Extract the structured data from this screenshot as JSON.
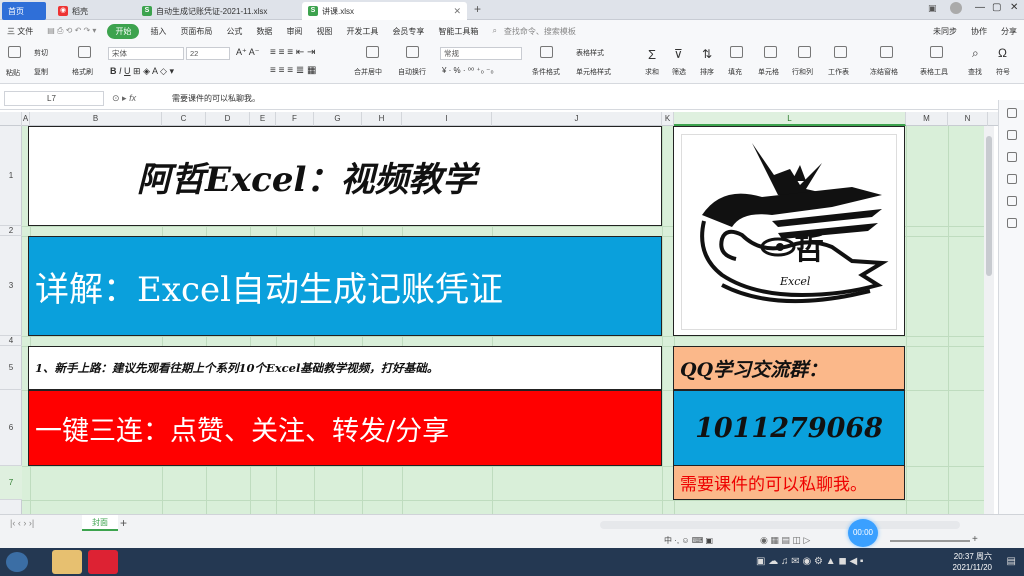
{
  "tabs": [
    {
      "label": "首页",
      "icon": "home-icon"
    },
    {
      "label": "稻壳",
      "icon": "docer-icon"
    },
    {
      "label": "自动生成记账凭证-2021-11.xlsx",
      "icon": "sheet-icon"
    },
    {
      "label": "讲课.xlsx",
      "icon": "sheet-icon"
    }
  ],
  "menu": {
    "file": "三 文件",
    "items": [
      "开始",
      "插入",
      "页面布局",
      "公式",
      "数据",
      "审阅",
      "视图",
      "开发工具",
      "会员专享",
      "智能工具箱"
    ],
    "search": "查找命令、搜索模板",
    "sync": "未同步",
    "collab": "协作",
    "share": "分享"
  },
  "ribbon": {
    "paste": "粘贴",
    "cut": "剪切",
    "copy": "复制",
    "format_painter": "格式刷",
    "font": "宋体",
    "size": "22",
    "merge": "合并居中",
    "wrap": "自动换行",
    "number_format": "常规",
    "cond_format": "条件格式",
    "table_style": "表格样式",
    "cell_style": "单元格样式",
    "sum": "求和",
    "filter": "筛选",
    "sort": "排序",
    "fill": "填充",
    "cell": "单元格",
    "rowcol": "行和列",
    "sheet": "工作表",
    "freeze": "冻结窗格",
    "table_tools": "表格工具",
    "find": "查找",
    "symbol": "符号"
  },
  "formula_bar": {
    "name_box": "L7",
    "fx": "fx",
    "content": "需要课件的可以私聊我。"
  },
  "columns": [
    "A",
    "B",
    "C",
    "D",
    "E",
    "F",
    "G",
    "H",
    "I",
    "J",
    "K",
    "L",
    "M",
    "N"
  ],
  "rows": [
    "1",
    "2",
    "3",
    "4",
    "5",
    "6",
    "7"
  ],
  "cells": {
    "title": "阿哲Excel：视频教学",
    "subtitle": "详解：Excel自动生成记账凭证",
    "note": "1、新手上路：建议先观看往期上个系列10个Excel基础教学视频，打好基础。",
    "red_banner": "一键三连：点赞、关注、转发/分享",
    "qq_label": "QQ学习交流群：",
    "qq_number": "1011279068",
    "private_msg": "需要课件的可以私聊我。",
    "logo_text": "Excel"
  },
  "sheet_tab": "封面",
  "zoom_badge": "00:00",
  "clock": {
    "time": "20:37 周六",
    "date": "2021/11/20"
  },
  "colors": {
    "blue": "#0aa0dc",
    "red": "#ff0000",
    "peach": "#fbb88a",
    "green": "#3da34e"
  }
}
